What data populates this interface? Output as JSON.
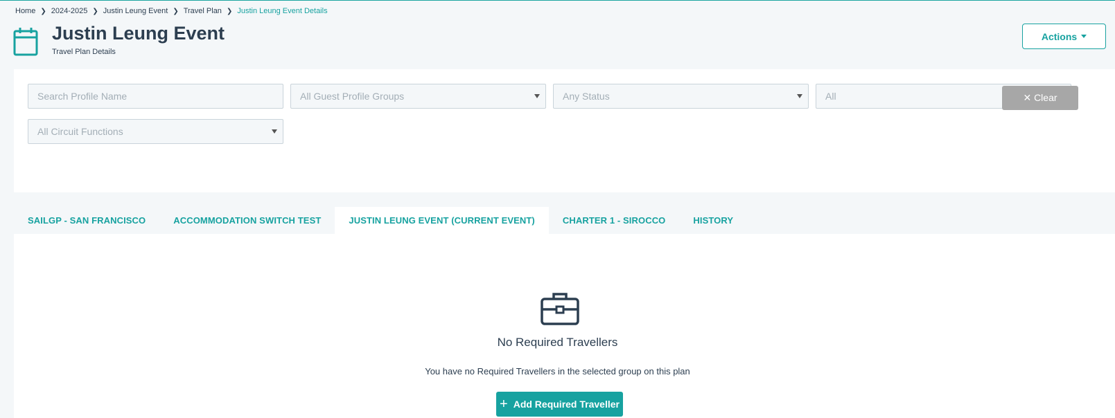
{
  "breadcrumb": {
    "items": [
      "Home",
      "2024-2025",
      "Justin Leung Event",
      "Travel Plan"
    ],
    "current": "Justin Leung Event Details"
  },
  "header": {
    "icon": "calendar-icon",
    "title": "Justin Leung Event",
    "subtitle": "Travel Plan Details",
    "actions_label": "Actions"
  },
  "filters": {
    "search_placeholder": "Search Profile Name",
    "guest_groups": "All Guest Profile Groups",
    "status": "Any Status",
    "all": "All",
    "circuit_functions": "All Circuit Functions",
    "clear_label": "✕ Clear"
  },
  "tabs": [
    {
      "label": "SAILGP - SAN FRANCISCO",
      "active": false
    },
    {
      "label": "ACCOMMODATION SWITCH TEST",
      "active": false
    },
    {
      "label": "JUSTIN LEUNG EVENT (CURRENT EVENT)",
      "active": true
    },
    {
      "label": "CHARTER 1 - SIROCCO",
      "active": false
    },
    {
      "label": "HISTORY",
      "active": false
    }
  ],
  "empty_state": {
    "icon": "briefcase-icon",
    "title": "No Required Travellers",
    "description": "You have no Required Travellers in the selected group on this plan",
    "button_label": "Add Required Traveller"
  },
  "colors": {
    "accent": "#17a2a0",
    "text": "#2c3e50",
    "page_bg": "#f4f7f9",
    "clear_button": "#a7a7a7"
  }
}
